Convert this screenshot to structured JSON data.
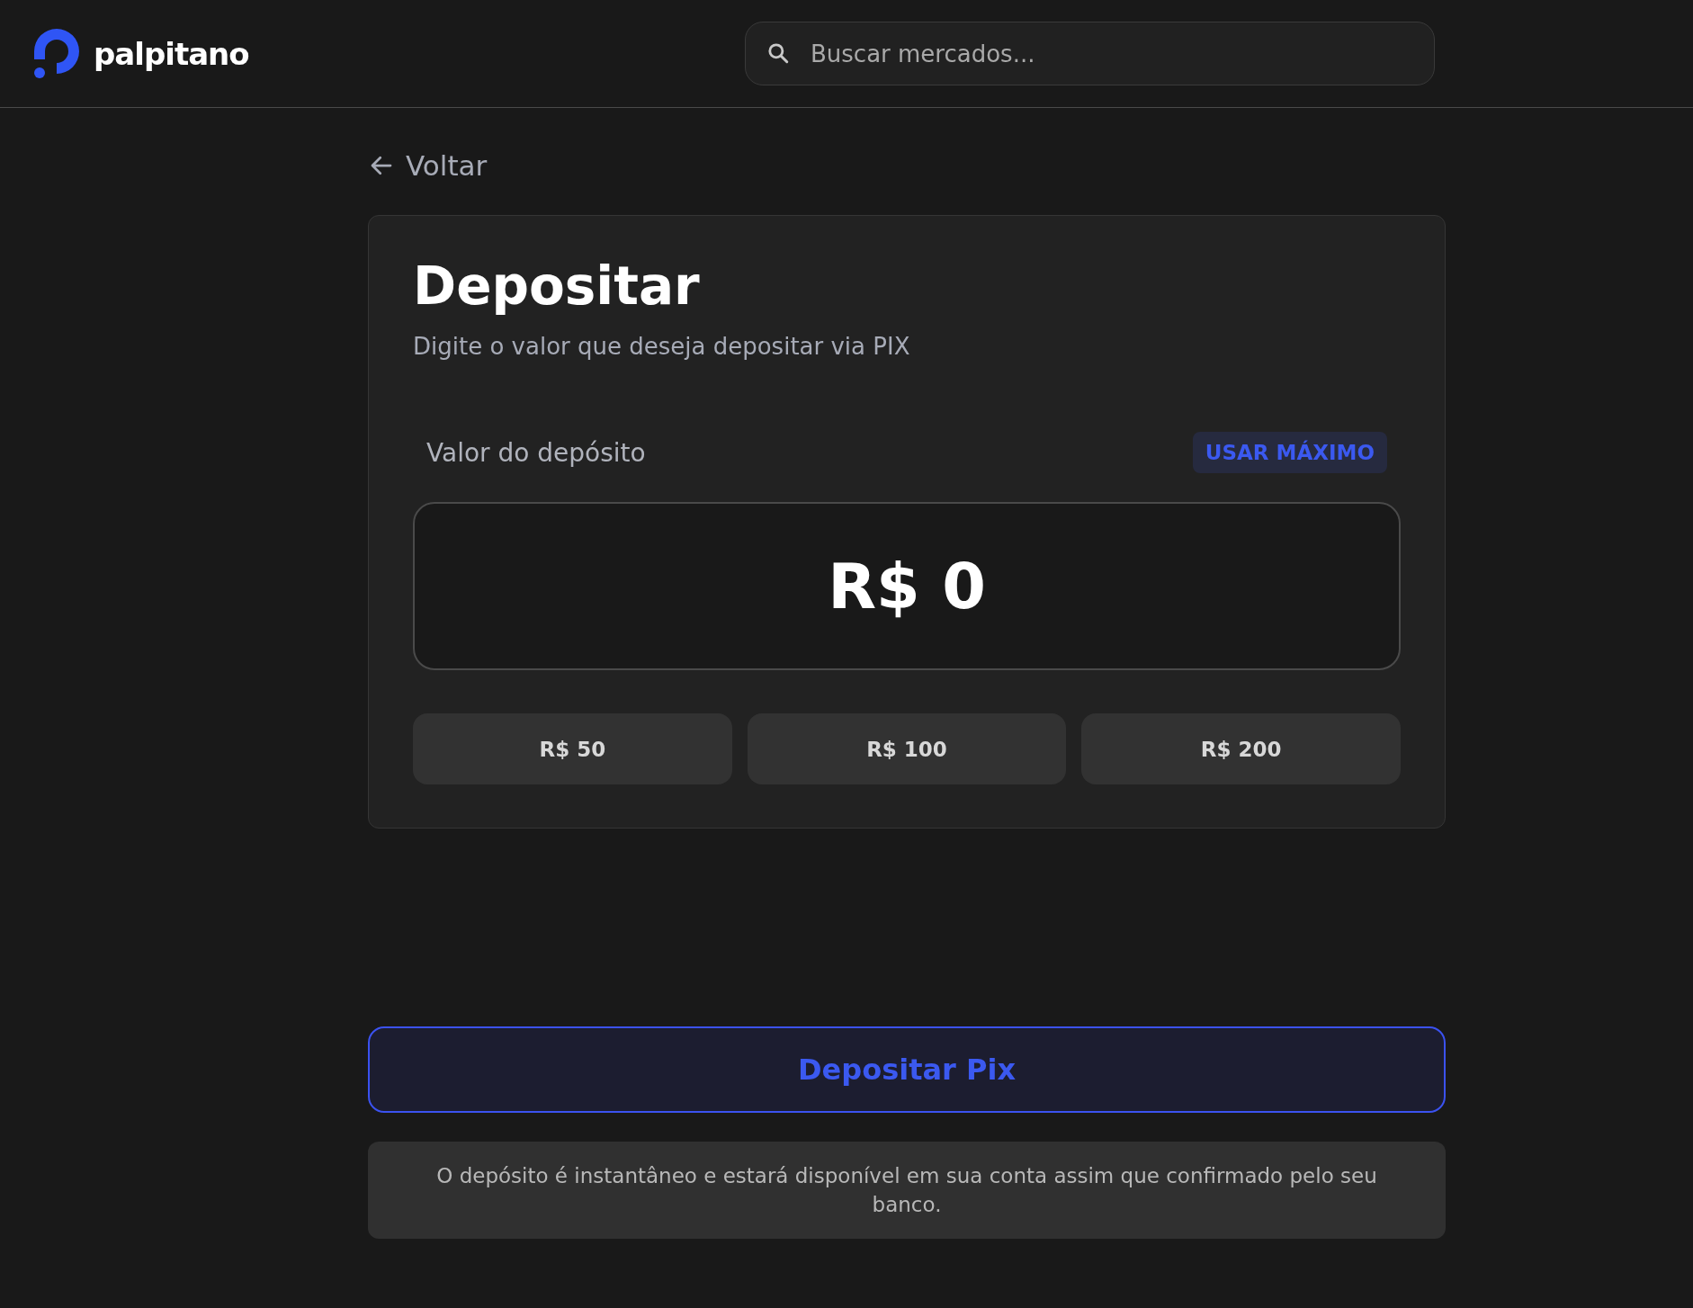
{
  "header": {
    "logo_text": "palpitano",
    "search": {
      "placeholder": "Buscar mercados..."
    }
  },
  "back_link": "Voltar",
  "card": {
    "title": "Depositar",
    "subtitle": "Digite o valor que deseja depositar via PIX",
    "amount_label": "Valor do depósito",
    "max_button": "USAR MÁXIMO",
    "amount_value": "R$ 0",
    "presets": [
      "R$ 50",
      "R$ 100",
      "R$ 200"
    ]
  },
  "submit_button": "Depositar Pix",
  "note": "O depósito é instantâneo e estará disponível em sua conta assim que confirmado pelo seu banco."
}
